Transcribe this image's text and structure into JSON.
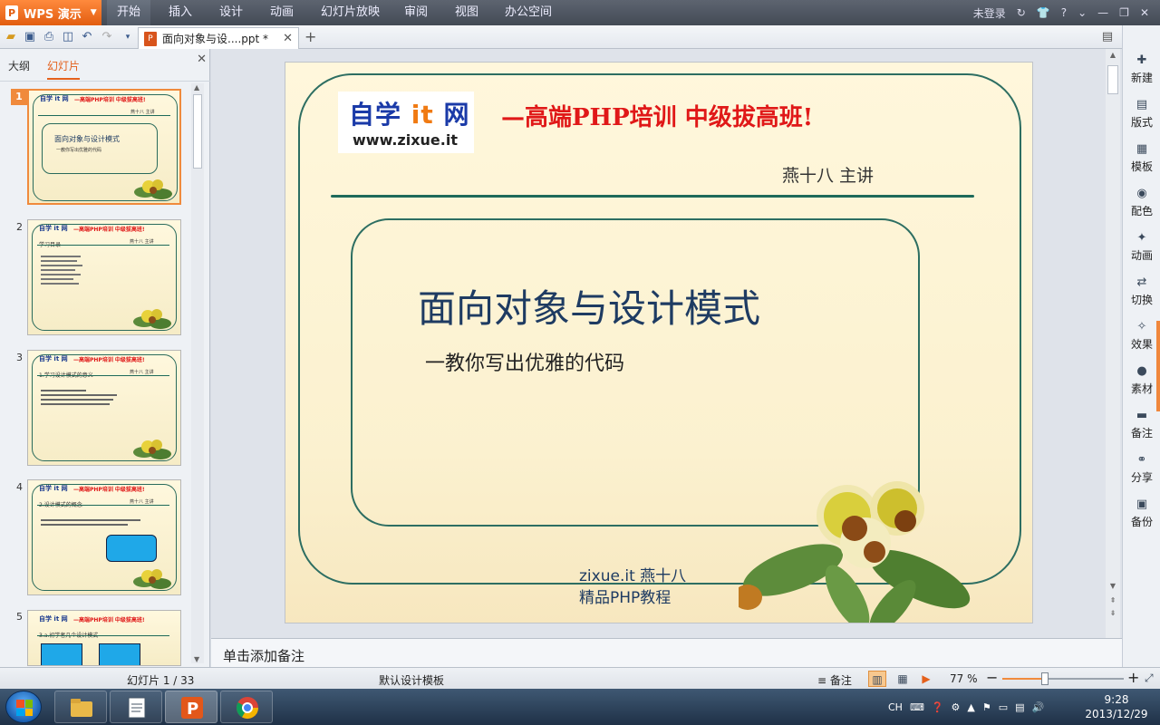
{
  "app": {
    "menu_label": "WPS 演示",
    "logo_letter": "P"
  },
  "ribbon_tabs": [
    "开始",
    "插入",
    "设计",
    "动画",
    "幻灯片放映",
    "审阅",
    "视图",
    "办公空间"
  ],
  "title_right": {
    "login": "未登录",
    "help": "?"
  },
  "document_tab": {
    "title": "面向对象与设....ppt *",
    "icon_letter": "P"
  },
  "panel": {
    "tab_outline": "大纲",
    "tab_slides": "幻灯片"
  },
  "thumbnails": [
    {
      "number": "1",
      "logo": "自学 it 网",
      "headline": "—高端PHP培训 中级拔高班!",
      "speaker": "燕十八 主讲",
      "title": "面向对象与设计模式",
      "subtitle": "一教你写出优雅的代码"
    },
    {
      "number": "2",
      "logo": "自学 it 网",
      "headline": "—高端PHP培训 中级拔高班!",
      "speaker": "燕十八 主讲",
      "heading": "学习目录"
    },
    {
      "number": "3",
      "logo": "自学 it 网",
      "headline": "—高端PHP培训 中级拔高班!",
      "speaker": "燕十八 主讲",
      "heading": "1.学习设计模式的意义"
    },
    {
      "number": "4",
      "logo": "自学 it 网",
      "headline": "—高端PHP培训 中级拔高班!",
      "speaker": "燕十八 主讲",
      "heading": "2.设计模式的概念"
    },
    {
      "number": "5",
      "logo": "自学 it 网",
      "headline": "—高端PHP培训 中级拔高班!",
      "heading": "3.a.初学者几个设计模式"
    }
  ],
  "slide": {
    "logo_main": "自学",
    "logo_it": "it",
    "logo_net": "网",
    "logo_url": "www.zixue.it",
    "headline": "—高端PHP培训  中级拔高班!",
    "speaker": "燕十八 主讲",
    "title": "面向对象与设计模式",
    "subtitle": "一教你写出优雅的代码",
    "footer_line1": "zixue.it 燕十八",
    "footer_line2": "精品PHP教程"
  },
  "notes_placeholder": "单击添加备注",
  "sidebar": [
    {
      "label": "新建",
      "icon": "new-icon"
    },
    {
      "label": "版式",
      "icon": "layout-icon"
    },
    {
      "label": "模板",
      "icon": "template-icon"
    },
    {
      "label": "配色",
      "icon": "palette-icon"
    },
    {
      "label": "动画",
      "icon": "animation-icon"
    },
    {
      "label": "切换",
      "icon": "transition-icon"
    },
    {
      "label": "效果",
      "icon": "effect-icon"
    },
    {
      "label": "素材",
      "icon": "material-icon"
    },
    {
      "label": "备注",
      "icon": "notes-icon"
    },
    {
      "label": "分享",
      "icon": "share-icon"
    },
    {
      "label": "备份",
      "icon": "backup-icon"
    }
  ],
  "status": {
    "slide_counter": "幻灯片 1 / 33",
    "template": "默认设计模板",
    "notes_label": "备注",
    "zoom": "77 %",
    "zoom_fraction": 0.35
  },
  "taskbar": {
    "ime": "CH",
    "time": "9:28",
    "date": "2013/12/29"
  },
  "colors": {
    "accent": "#f08a3c",
    "slide_headline": "#e01818",
    "slide_title": "#1e3b62",
    "frame": "#2d6e62"
  }
}
